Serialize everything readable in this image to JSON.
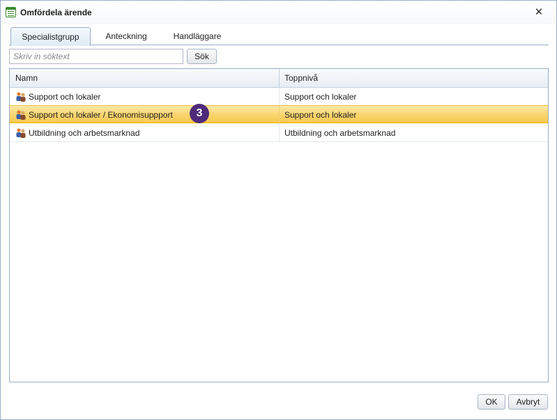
{
  "window": {
    "title": "Omfördela ärende",
    "icon": "document-list-icon"
  },
  "tabs": [
    {
      "label": "Specialistgrupp",
      "active": true
    },
    {
      "label": "Anteckning",
      "active": false
    },
    {
      "label": "Handläggare",
      "active": false
    }
  ],
  "search": {
    "placeholder": "Skriv in söktext",
    "value": "",
    "button_label": "Sök"
  },
  "grid": {
    "columns": [
      "Namn",
      "Toppnivå"
    ],
    "rows": [
      {
        "name": "Support och lokaler",
        "top": "Support och lokaler",
        "selected": false,
        "icon": "group-icon"
      },
      {
        "name": "Support och lokaler / Ekonomisuppport",
        "top": "Support och lokaler",
        "selected": true,
        "icon": "group-icon"
      },
      {
        "name": "Utbildning och arbetsmarknad",
        "top": "Utbildning och arbetsmarknad",
        "selected": false,
        "icon": "group-icon"
      }
    ]
  },
  "annotation": {
    "badge": "3",
    "color": "#4f2a7a"
  },
  "footer": {
    "ok_label": "OK",
    "cancel_label": "Avbryt"
  },
  "colors": {
    "border": "#99aec6",
    "selected_row": "#f9d46d",
    "icon_green": "#3b8a2e"
  }
}
